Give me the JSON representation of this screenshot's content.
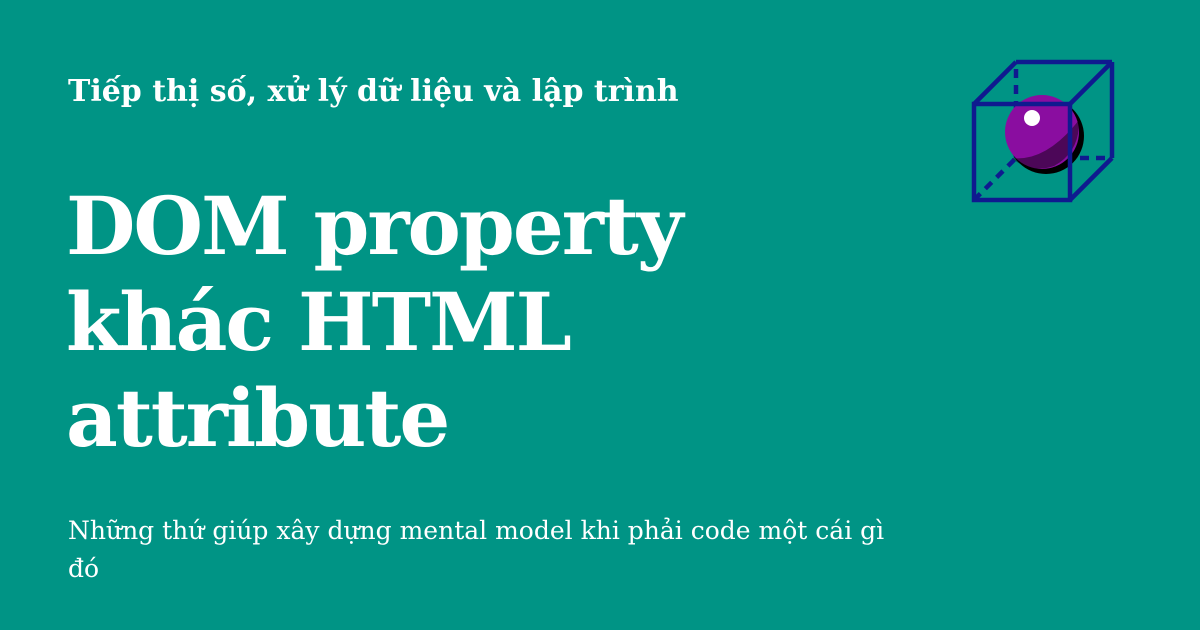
{
  "card": {
    "background": "#009485",
    "text_color": "#ffffff",
    "site_name": "Tiếp thị số, xử lý dữ liệu và lập trình",
    "title": "DOM property khác HTML attribute",
    "subtitle": "Những thứ giúp xây dựng mental model khi phải code một cái gì đó"
  },
  "logo": {
    "icon": "cube-sphere-icon",
    "cube_color": "#0f1a8f",
    "sphere_color": "#8a0da0",
    "sphere_shadow": "#000000",
    "highlight_color": "#ffffff"
  }
}
